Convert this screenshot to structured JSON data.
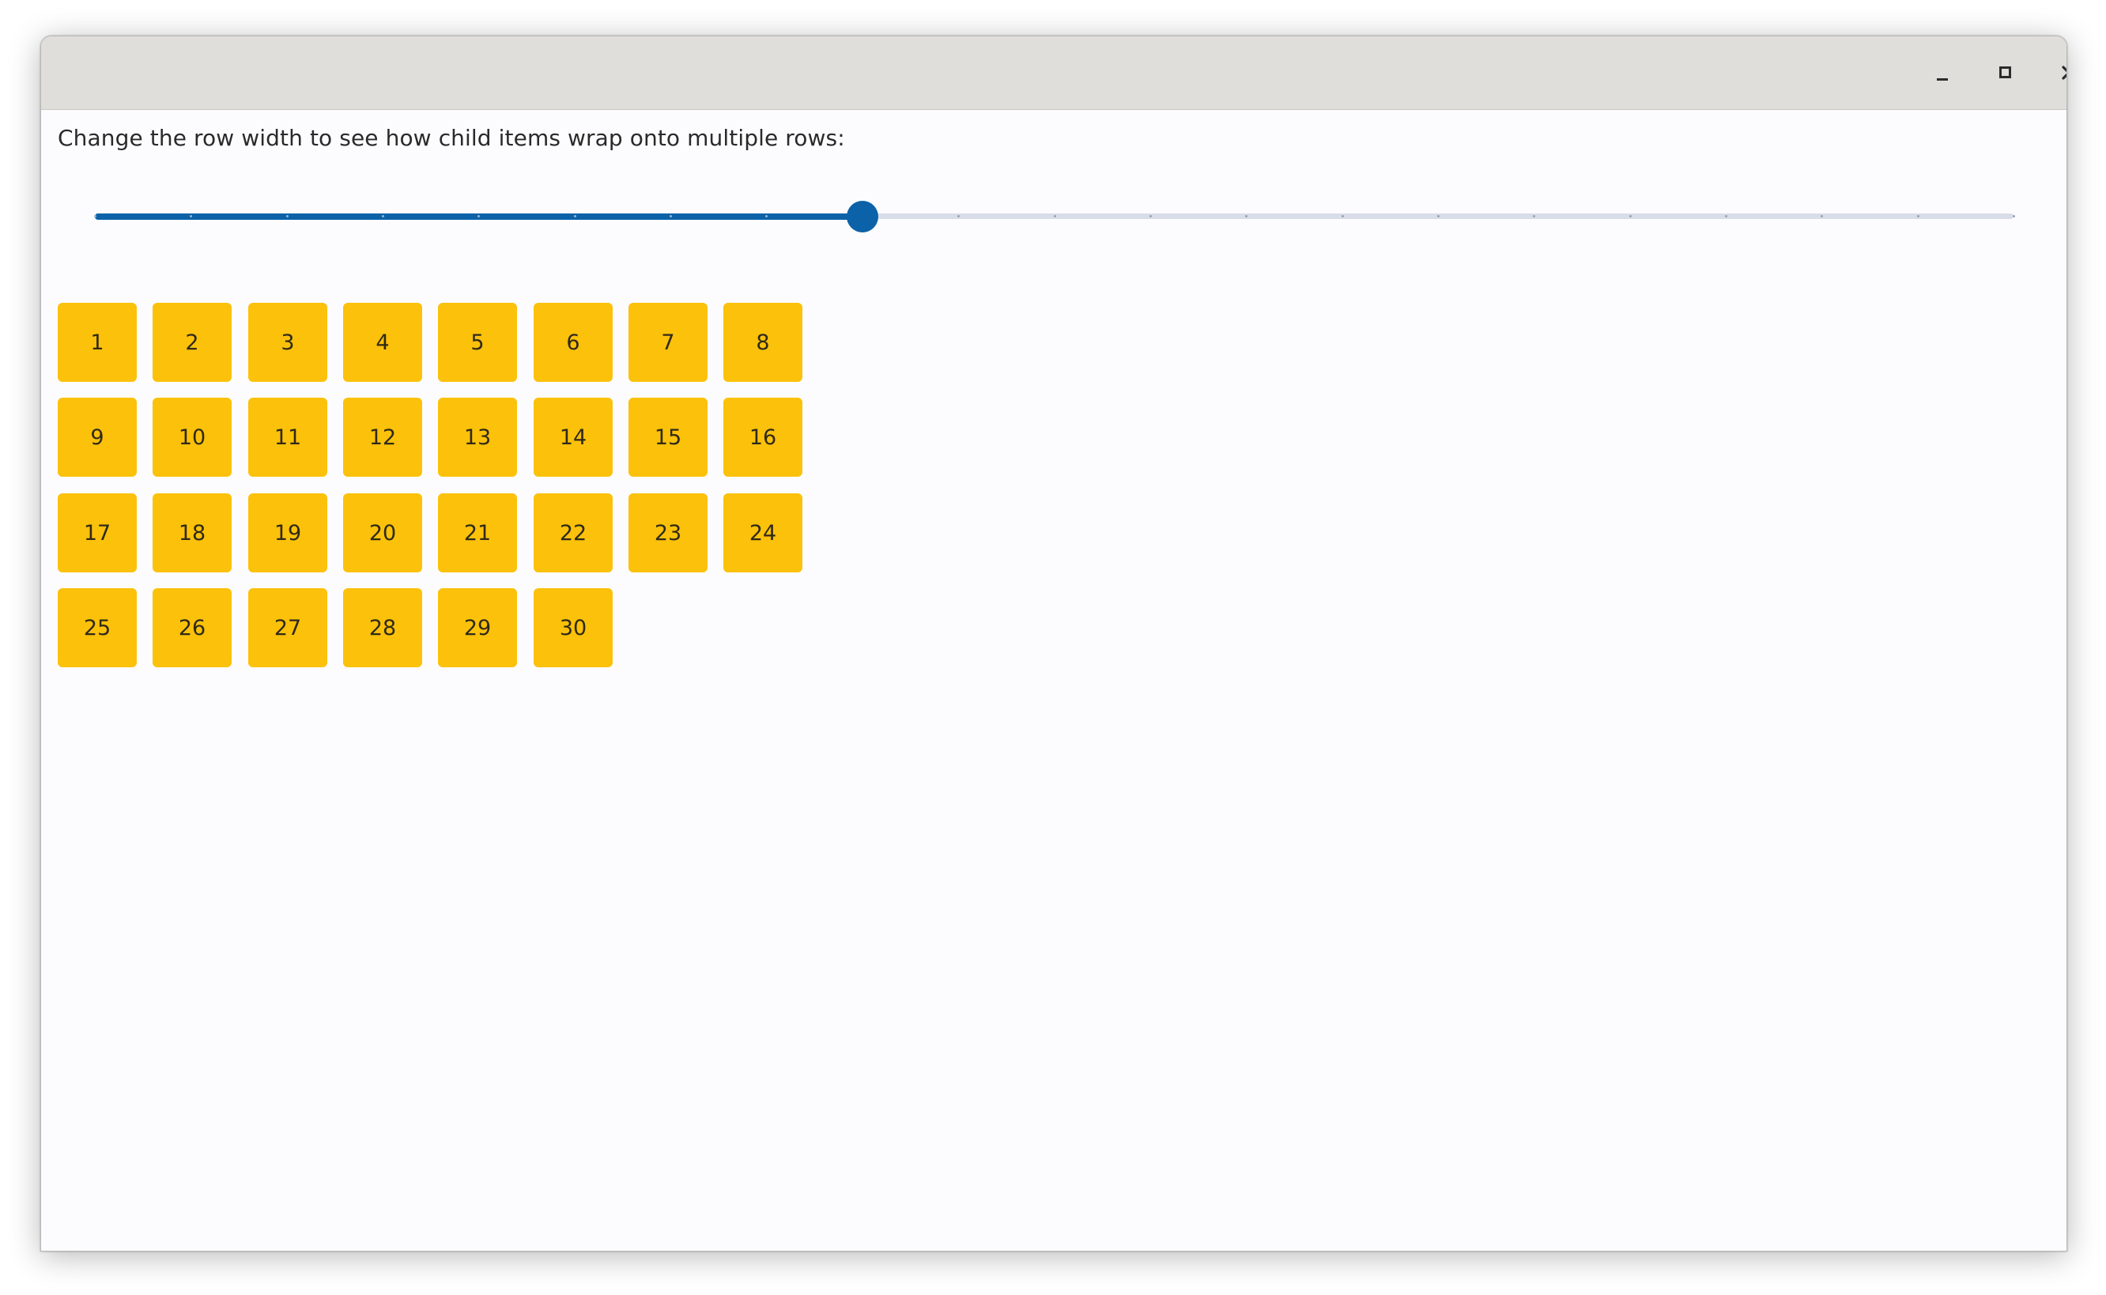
{
  "window": {
    "controls": {
      "minimize_icon": "minimize-icon",
      "maximize_icon": "maximize-icon",
      "close_icon": "close-icon"
    }
  },
  "content": {
    "instruction": "Change the row width to see how child items wrap onto multiple rows:",
    "slider": {
      "min": 0,
      "max": 20,
      "value": 8,
      "ticks": 21
    },
    "items": [
      "1",
      "2",
      "3",
      "4",
      "5",
      "6",
      "7",
      "8",
      "9",
      "10",
      "11",
      "12",
      "13",
      "14",
      "15",
      "16",
      "17",
      "18",
      "19",
      "20",
      "21",
      "22",
      "23",
      "24",
      "25",
      "26",
      "27",
      "28",
      "29",
      "30"
    ],
    "items_per_row": 8
  },
  "colors": {
    "titlebar": "#e0deda",
    "background": "#fcfcfe",
    "accent": "#0b62a8",
    "tile": "#fcc10a"
  }
}
